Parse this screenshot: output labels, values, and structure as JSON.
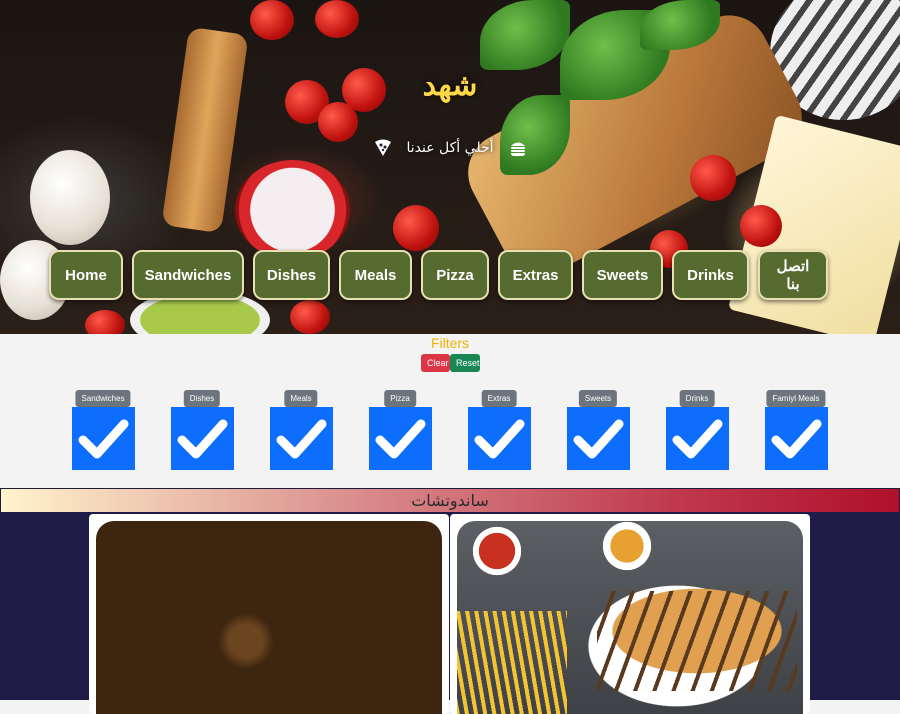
{
  "hero": {
    "title": "شهد",
    "tagline": "أحلي أكل عندنا",
    "icons": [
      "pizza-icon",
      "burger-icon"
    ]
  },
  "nav": {
    "items": [
      "Home",
      "Sandwiches",
      "Dishes",
      "Meals",
      "Pizza",
      "Extras",
      "Sweets",
      "Drinks",
      "اتصل بنا"
    ]
  },
  "filters": {
    "title": "Filters",
    "clear_label": "Clear",
    "reset_label": "Reset",
    "items": [
      {
        "label": "Sandwiches",
        "checked": true
      },
      {
        "label": "Dishes",
        "checked": true
      },
      {
        "label": "Meals",
        "checked": true
      },
      {
        "label": "Pizza",
        "checked": true
      },
      {
        "label": "Extras",
        "checked": true
      },
      {
        "label": "Sweets",
        "checked": true
      },
      {
        "label": "Drinks",
        "checked": true
      },
      {
        "label": "Famiyl Meals",
        "checked": true
      }
    ]
  },
  "section": {
    "title": "ساندوتشات"
  },
  "colors": {
    "nav_bg": "#556b2f",
    "title": "#ffd84a",
    "filters_title": "#f0b400",
    "checkbox": "#0d6efd",
    "clear": "#dc3545",
    "reset": "#198754",
    "section_bg": "#1f1d47"
  }
}
